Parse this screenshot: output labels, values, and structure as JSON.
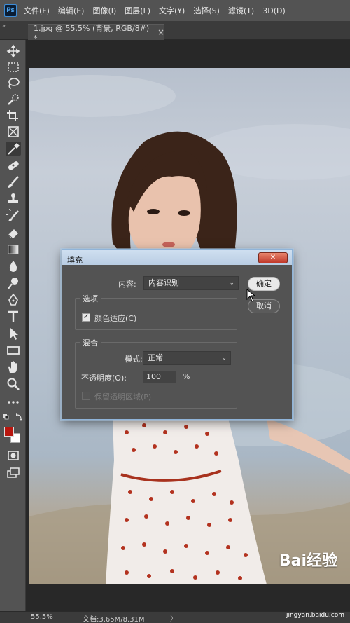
{
  "app": {
    "logo": "Ps"
  },
  "menu": [
    "文件(F)",
    "编辑(E)",
    "图像(I)",
    "图层(L)",
    "文字(Y)",
    "选择(S)",
    "滤镜(T)",
    "3D(D)"
  ],
  "tab": {
    "title": "1.jpg @ 55.5% (背景, RGB/8#) *",
    "close": "×"
  },
  "tools": [
    "move-icon",
    "marquee-icon",
    "lasso-icon",
    "quick-select-icon",
    "crop-icon",
    "frame-icon",
    "eyedropper-icon",
    "healing-brush-icon",
    "brush-icon",
    "clone-stamp-icon",
    "history-brush-icon",
    "eraser-icon",
    "gradient-icon",
    "blur-icon",
    "dodge-icon",
    "pen-icon",
    "type-icon",
    "path-select-icon",
    "rectangle-icon",
    "hand-icon",
    "zoom-icon",
    "more-icon",
    "swap-colors-icon",
    "quick-mask-icon",
    "screen-mode-icon"
  ],
  "colors": {
    "foreground": "#b8160e",
    "background": "#ffffff"
  },
  "dialog": {
    "title": "填充",
    "close": "✕",
    "content_label": "内容:",
    "content_value": "内容识别",
    "options_group": "选项",
    "color_adapt_label": "颜色适应(C)",
    "color_adapt_checked": "✓",
    "blend_group": "混合",
    "mode_label": "模式:",
    "mode_value": "正常",
    "opacity_label": "不透明度(O):",
    "opacity_value": "100",
    "opacity_unit": "%",
    "preserve_label": "保留透明区域(P)",
    "ok": "确定",
    "cancel": "取消"
  },
  "status": {
    "zoom": "55.5%",
    "doc": "文档:3.65M/8.31M",
    "arrow": "〉",
    "watermark": "jingyan.baidu.com",
    "wm_logo": "Bai经验"
  }
}
